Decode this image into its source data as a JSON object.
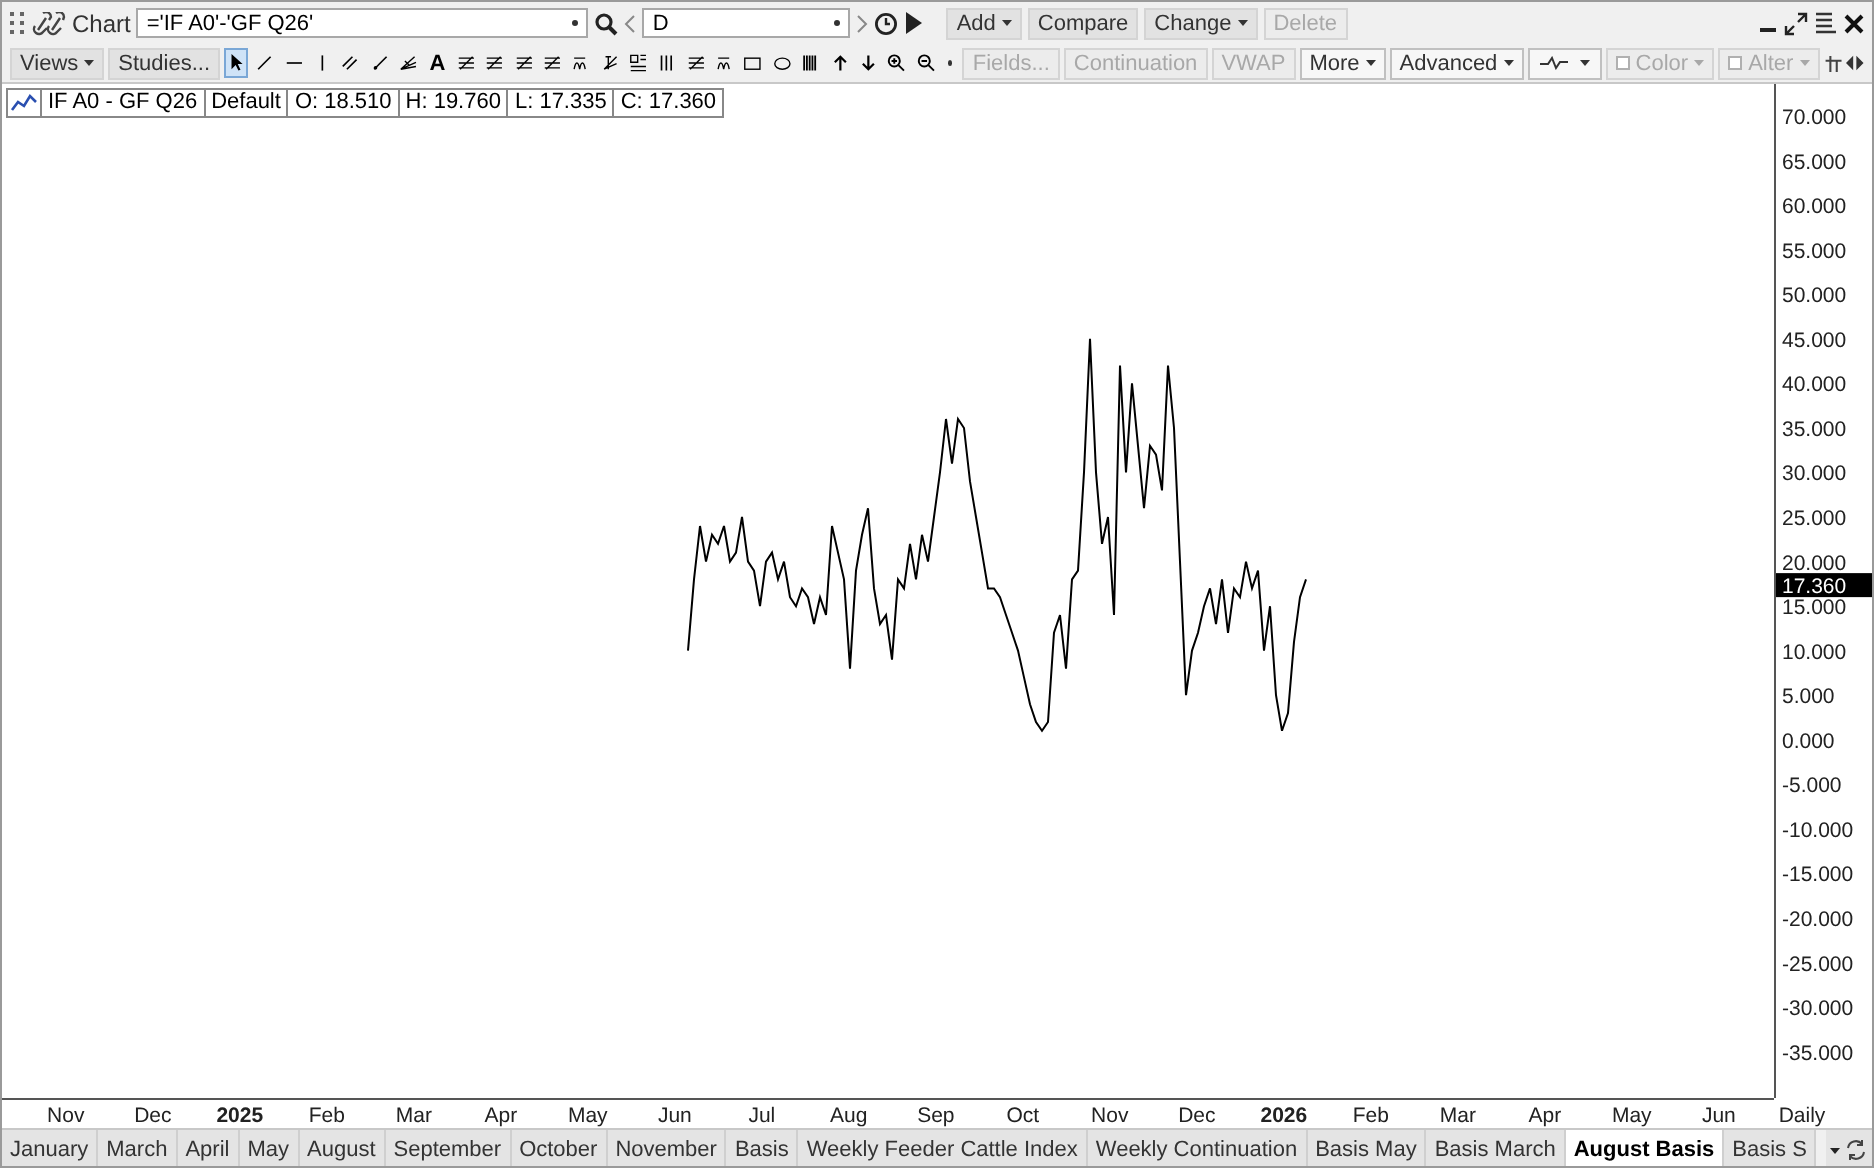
{
  "title_bar": {
    "title": "Chart",
    "symbol": "='IF A0'-'GF Q26'",
    "period": "D",
    "buttons": [
      {
        "label": "Add",
        "dropdown": true,
        "disabled": false
      },
      {
        "label": "Compare",
        "dropdown": false,
        "disabled": false
      },
      {
        "label": "Change",
        "dropdown": true,
        "disabled": false
      },
      {
        "label": "Delete",
        "dropdown": false,
        "disabled": true
      }
    ]
  },
  "toolbar": {
    "left_buttons": [
      {
        "label": "Views",
        "dropdown": true
      },
      {
        "label": "Studies...",
        "dropdown": false
      }
    ],
    "tools": [
      {
        "kind": "pointer",
        "selected": true
      },
      {
        "kind": "line",
        "selected": false
      },
      {
        "kind": "hline",
        "selected": false
      },
      {
        "kind": "vline",
        "selected": false
      },
      {
        "kind": "channel",
        "selected": false
      },
      {
        "kind": "ray",
        "selected": false
      },
      {
        "kind": "fan",
        "selected": false
      },
      {
        "kind": "text",
        "glyph": "A",
        "selected": false
      },
      {
        "kind": "fib",
        "selected": false
      },
      {
        "kind": "fib",
        "selected": false
      },
      {
        "kind": "fib",
        "selected": false
      },
      {
        "kind": "fib",
        "selected": false
      },
      {
        "kind": "cycle",
        "selected": false
      },
      {
        "kind": "speed",
        "selected": false
      },
      {
        "kind": "grid",
        "selected": false
      },
      {
        "kind": "columns",
        "selected": false
      },
      {
        "kind": "fib",
        "selected": false
      },
      {
        "kind": "cycle",
        "selected": false
      },
      {
        "kind": "rect",
        "selected": false
      },
      {
        "kind": "ellipse",
        "selected": false
      },
      {
        "kind": "bars",
        "selected": false
      },
      {
        "kind": "up",
        "selected": false
      },
      {
        "kind": "down",
        "selected": false
      },
      {
        "kind": "zoomin",
        "selected": false
      },
      {
        "kind": "zoomout",
        "selected": false
      }
    ],
    "right_buttons": [
      {
        "kind": "button",
        "label": "Fields...",
        "dropdown": false,
        "disabled": true
      },
      {
        "kind": "button",
        "label": "Continuation",
        "dropdown": false,
        "disabled": true
      },
      {
        "kind": "button",
        "label": "VWAP",
        "dropdown": false,
        "disabled": true
      },
      {
        "kind": "button",
        "label": "More",
        "dropdown": true,
        "disabled": false
      },
      {
        "kind": "button",
        "label": "Advanced",
        "dropdown": true,
        "disabled": false
      },
      {
        "kind": "style",
        "dropdown": true,
        "disabled": false
      },
      {
        "kind": "checkbox",
        "label": "Color",
        "checked": false,
        "dropdown": true,
        "disabled": true
      },
      {
        "kind": "checkbox",
        "label": "Alter",
        "checked": false,
        "dropdown": true,
        "disabled": true
      }
    ]
  },
  "legend": {
    "symbol": "IF A0 - GF Q26",
    "template": "Default",
    "open": "O: 18.510",
    "high": "H: 19.760",
    "low": "L: 17.335",
    "close": "C: 17.360"
  },
  "chart": {
    "last_value": "17.360",
    "x_axis_label": "Daily",
    "chart_data": {
      "type": "line",
      "x": [
        2025.4293,
        2025.435,
        2025.4408,
        2025.4465,
        2025.4523,
        2025.458,
        2025.4638,
        2025.4695,
        2025.4753,
        2025.481,
        2025.4868,
        2025.4925,
        2025.4983,
        2025.504,
        2025.5098,
        2025.5155,
        2025.5213,
        2025.527,
        2025.5327,
        2025.5385,
        2025.5442,
        2025.55,
        2025.5557,
        2025.5615,
        2025.5672,
        2025.573,
        2025.5787,
        2025.5845,
        2025.5902,
        2025.596,
        2025.6017,
        2025.6075,
        2025.6132,
        2025.619,
        2025.6247,
        2025.6305,
        2025.6362,
        2025.6419,
        2025.6477,
        2025.6534,
        2025.6592,
        2025.6649,
        2025.6707,
        2025.6764,
        2025.6822,
        2025.6879,
        2025.6937,
        2025.6994,
        2025.7052,
        2025.7109,
        2025.7167,
        2025.7224,
        2025.7282,
        2025.7339,
        2025.7396,
        2025.7454,
        2025.7511,
        2025.7569,
        2025.7626,
        2025.7684,
        2025.7741,
        2025.7799,
        2025.7856,
        2025.7914,
        2025.7971,
        2025.8029,
        2025.8086,
        2025.8144,
        2025.8201,
        2025.8258,
        2025.8316,
        2025.8373,
        2025.8431,
        2025.8488,
        2025.8546,
        2025.8603,
        2025.8661,
        2025.8718,
        2025.8776,
        2025.8833,
        2025.8891,
        2025.8948,
        2025.9006,
        2025.9063,
        2025.9121,
        2025.9178,
        2025.9235,
        2025.9293,
        2025.935,
        2025.9408,
        2025.9465,
        2025.9523,
        2025.958,
        2025.9638,
        2025.9695,
        2025.9753,
        2025.981,
        2025.9868,
        2025.9925,
        2025.9983,
        2026.004,
        2026.0098,
        2026.0155,
        2026.0213
      ],
      "xlim": [
        2024.7722,
        2026.4695
      ],
      "ylim": [
        -40.2,
        73.6
      ],
      "xticks": [
        {
          "value": 2024.8333,
          "label": "Nov"
        },
        {
          "value": 2024.9167,
          "label": "Dec"
        },
        {
          "value": 2025,
          "label": "2025"
        },
        {
          "value": 2025.0833,
          "label": "Feb"
        },
        {
          "value": 2025.1667,
          "label": "Mar"
        },
        {
          "value": 2025.25,
          "label": "Apr"
        },
        {
          "value": 2025.3333,
          "label": "May"
        },
        {
          "value": 2025.4167,
          "label": "Jun"
        },
        {
          "value": 2025.5,
          "label": "Jul"
        },
        {
          "value": 2025.5833,
          "label": "Aug"
        },
        {
          "value": 2025.6667,
          "label": "Sep"
        },
        {
          "value": 2025.75,
          "label": "Oct"
        },
        {
          "value": 2025.8333,
          "label": "Nov"
        },
        {
          "value": 2025.9167,
          "label": "Dec"
        },
        {
          "value": 2026,
          "label": "2026"
        },
        {
          "value": 2026.0833,
          "label": "Feb"
        },
        {
          "value": 2026.1667,
          "label": "Mar"
        },
        {
          "value": 2026.25,
          "label": "Apr"
        },
        {
          "value": 2026.3333,
          "label": "May"
        },
        {
          "value": 2026.4167,
          "label": "Jun"
        }
      ],
      "yticks": [
        {
          "value": 70,
          "label": "70.000"
        },
        {
          "value": 65,
          "label": "65.000"
        },
        {
          "value": 60,
          "label": "60.000"
        },
        {
          "value": 55,
          "label": "55.000"
        },
        {
          "value": 50,
          "label": "50.000"
        },
        {
          "value": 45,
          "label": "45.000"
        },
        {
          "value": 40,
          "label": "40.000"
        },
        {
          "value": 35,
          "label": "35.000"
        },
        {
          "value": 30,
          "label": "30.000"
        },
        {
          "value": 25,
          "label": "25.000"
        },
        {
          "value": 20,
          "label": "20.000"
        },
        {
          "value": 15,
          "label": "15.000"
        },
        {
          "value": 10,
          "label": "10.000"
        },
        {
          "value": 5,
          "label": "5.000"
        },
        {
          "value": 0,
          "label": "0.000"
        },
        {
          "value": -5,
          "label": "-5.000"
        },
        {
          "value": -10,
          "label": "-10.000"
        },
        {
          "value": -15,
          "label": "-15.000"
        },
        {
          "value": -20,
          "label": "-20.000"
        },
        {
          "value": -25,
          "label": "-25.000"
        },
        {
          "value": -30,
          "label": "-30.000"
        },
        {
          "value": -35,
          "label": "-35.000"
        }
      ],
      "series": [
        {
          "color": "#000000",
          "values": [
            10,
            18,
            24,
            20,
            23,
            22,
            24,
            20,
            21,
            25,
            20,
            19,
            15,
            20,
            21,
            18,
            20,
            16,
            15,
            17,
            16,
            13,
            16,
            14,
            24,
            21,
            18,
            8,
            19,
            23,
            26,
            17,
            13,
            14,
            9,
            18,
            17,
            22,
            18,
            23,
            20,
            25,
            30,
            36,
            31,
            36,
            35,
            29,
            25,
            21,
            17,
            17,
            16,
            14,
            12,
            10,
            7,
            4,
            2,
            1,
            2,
            12,
            14,
            8,
            18,
            19,
            30,
            45,
            30,
            22,
            25,
            14,
            42,
            30,
            40,
            33,
            26,
            33,
            32,
            28,
            42,
            35,
            20,
            5,
            10,
            12,
            15,
            17,
            13,
            18,
            12,
            17,
            16,
            20,
            17,
            19,
            10,
            15,
            5,
            1,
            3,
            11,
            16,
            18
          ]
        }
      ]
    }
  },
  "tabs": [
    {
      "label": "January",
      "selected": false
    },
    {
      "label": "March",
      "selected": false
    },
    {
      "label": "April",
      "selected": false
    },
    {
      "label": "May",
      "selected": false
    },
    {
      "label": "August",
      "selected": false
    },
    {
      "label": "September",
      "selected": false
    },
    {
      "label": "October",
      "selected": false
    },
    {
      "label": "November",
      "selected": false
    },
    {
      "label": "Basis",
      "selected": false
    },
    {
      "label": "Weekly Feeder Cattle Index",
      "selected": false
    },
    {
      "label": "Weekly Continuation",
      "selected": false
    },
    {
      "label": "Basis May",
      "selected": false
    },
    {
      "label": "Basis March",
      "selected": false
    },
    {
      "label": "August Basis",
      "selected": true
    },
    {
      "label": "Basis S",
      "selected": false
    }
  ]
}
